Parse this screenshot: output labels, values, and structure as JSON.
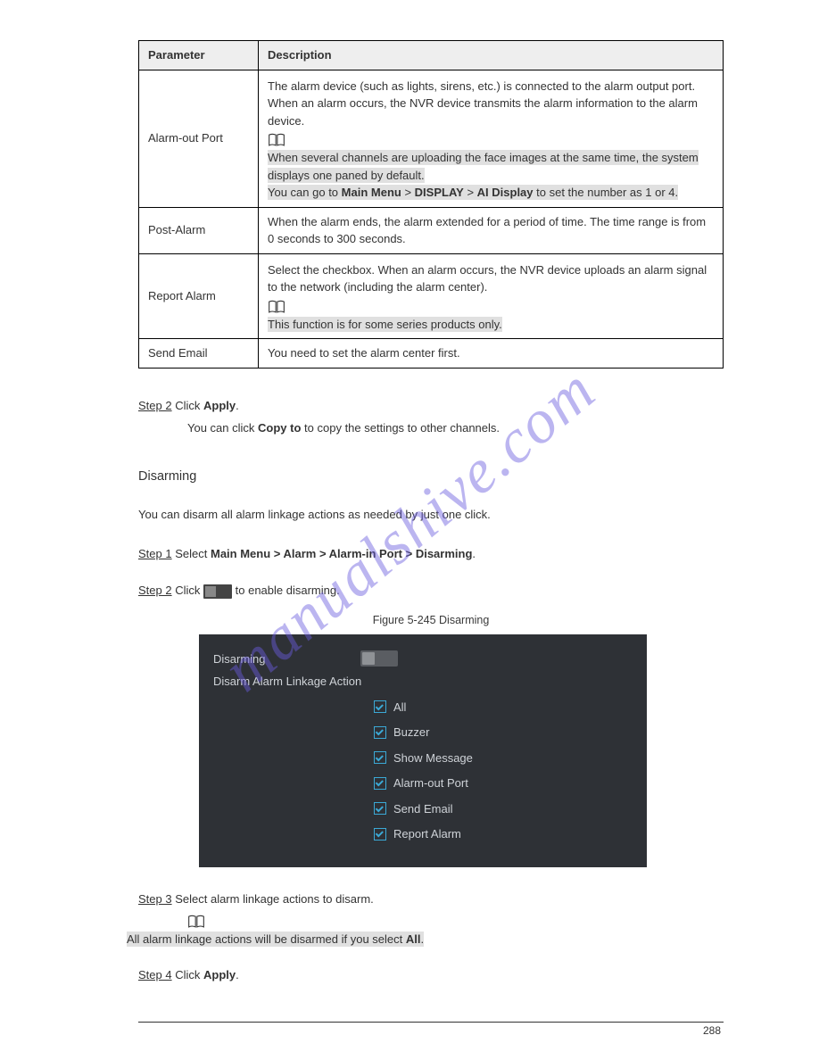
{
  "table": {
    "headers": [
      "Parameter",
      "Description"
    ],
    "rows": [
      {
        "param": "Alarm-out Port",
        "desc_line1": "The alarm device (such as lights, sirens, etc.) is connected to the alarm output port. When an alarm occurs, the NVR device transmits the alarm information to the alarm device.",
        "note_line1": "When several channels are uploading the face images at the same time, the system displays one paned by default.",
        "note_line2a": "You can go to",
        "note_bold": "Main Menu",
        "note_sep": " > ",
        "note_bold2": "DISPLAY",
        "note_sep2": " > ",
        "note_bold3": "AI Display",
        "note_line2b": "to set the number as 1 or 4."
      },
      {
        "param": "Post-Alarm",
        "desc_line1": "When the alarm ends, the alarm extended for a period of time. The time range is from 0 seconds to 300 seconds."
      },
      {
        "param": "Report Alarm",
        "desc_line1": "Select the checkbox. When an alarm occurs, the NVR device uploads an alarm signal to the network (including the alarm center).",
        "note_line1": "This function is for some series products only."
      },
      {
        "param": "Send Email",
        "desc_line1": "You need to set the alarm center first."
      }
    ]
  },
  "step2": {
    "label": "Step 2",
    "text": "Click",
    "bold": "Apply",
    "suffix": ".",
    "para1_a": "You can click",
    "para1_b": "Copy to",
    "para1_c": "to copy the settings to other channels."
  },
  "heading": "Disarming",
  "disarm_desc": "You can disarm all alarm linkage actions as needed by just one click.",
  "step1": {
    "label": "Step 1",
    "text_a": "Select",
    "bold_path": "Main Menu > Alarm > Alarm-in Port > Disarming",
    "suffix": "."
  },
  "step2b": {
    "label": "Step 2",
    "text_a": "Click",
    "suffix": "to enable disarming."
  },
  "figure_caption": "Figure 5-245 Disarming",
  "screenshot": {
    "row1_label": "Disarming",
    "row2_label": "Disarm Alarm Linkage Action",
    "checks": [
      "All",
      "Buzzer",
      "Show Message",
      "Alarm-out Port",
      "Send Email",
      "Report Alarm"
    ]
  },
  "step3": {
    "label": "Step 3",
    "text": "Select alarm linkage actions to disarm.",
    "note": "All alarm linkage actions will be disarmed if you select",
    "note_bold": "All",
    "note_suffix": "."
  },
  "step4": {
    "label": "Step 4",
    "text_a": "Click",
    "bold": "Apply",
    "suffix": "."
  },
  "page_number": "288",
  "watermark": "manualshive.com"
}
